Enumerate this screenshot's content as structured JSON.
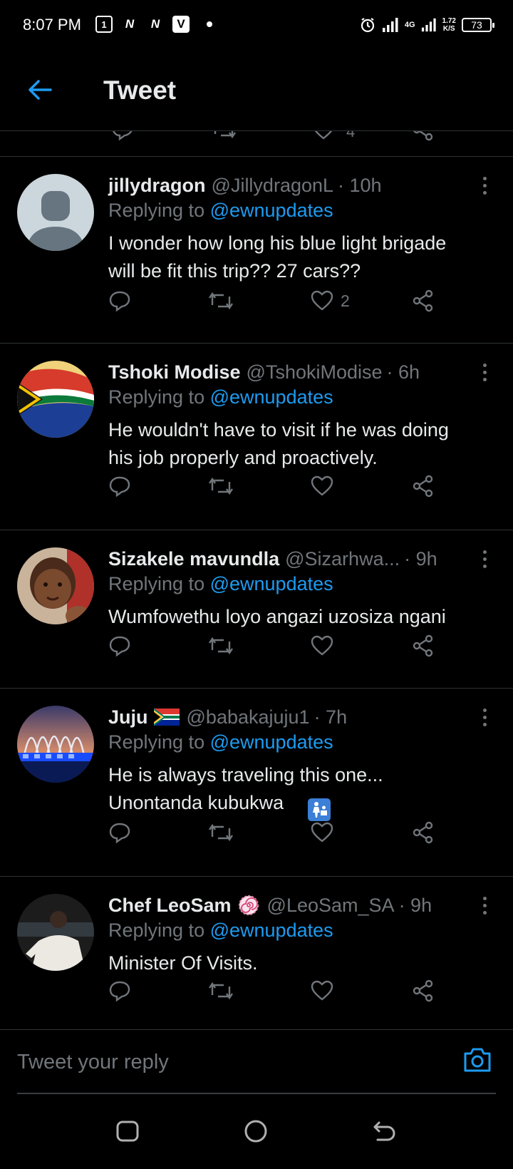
{
  "status_bar": {
    "time": "8:07 PM",
    "network": "4G",
    "speed_value": "1.72",
    "speed_unit": "K/S",
    "battery": "73"
  },
  "header": {
    "title": "Tweet",
    "back_icon": "arrow-left-icon"
  },
  "partial_tweet": {
    "like_count": "4"
  },
  "tweets": [
    {
      "name": "jillydragon",
      "handle": "@JillydragonL",
      "time": "· 10h",
      "replying_prefix": "Replying to ",
      "replying_to": "@ewnupdates",
      "text": "I wonder how long his blue light brigade\nwill be fit this trip??  27 cars??",
      "like_count": "2"
    },
    {
      "name": "Tshoki Modise",
      "handle": "@TshokiModise",
      "time": "· 6h",
      "replying_prefix": "Replying to ",
      "replying_to": "@ewnupdates",
      "text": "He wouldn't have to visit if he was doing\nhis job properly and proactively.",
      "like_count": ""
    },
    {
      "name": "Sizakele mavundla",
      "handle": "@Sizarhwa...",
      "time": "· 9h",
      "replying_prefix": "Replying to ",
      "replying_to": "@ewnupdates",
      "text": "Wumfowethu loyo angazi uzosiza ngani",
      "like_count": ""
    },
    {
      "name": "Juju",
      "handle": "@babakajuju1",
      "time": "· 7h",
      "replying_prefix": "Replying to ",
      "replying_to": "@ewnupdates",
      "text": "He is always traveling this one...\nUnontanda kubukwa",
      "like_count": ""
    },
    {
      "name": "Chef LeoSam",
      "handle": "@LeoSam_SA",
      "time": "· 9h",
      "replying_prefix": "Replying to ",
      "replying_to": "@ewnupdates",
      "text": "Minister Of Visits.",
      "like_count": ""
    }
  ],
  "compose": {
    "placeholder": "Tweet your reply"
  },
  "colors": {
    "accent": "#1d9bf0",
    "background": "#000000",
    "muted": "#71767b",
    "divider": "#2f3336"
  }
}
